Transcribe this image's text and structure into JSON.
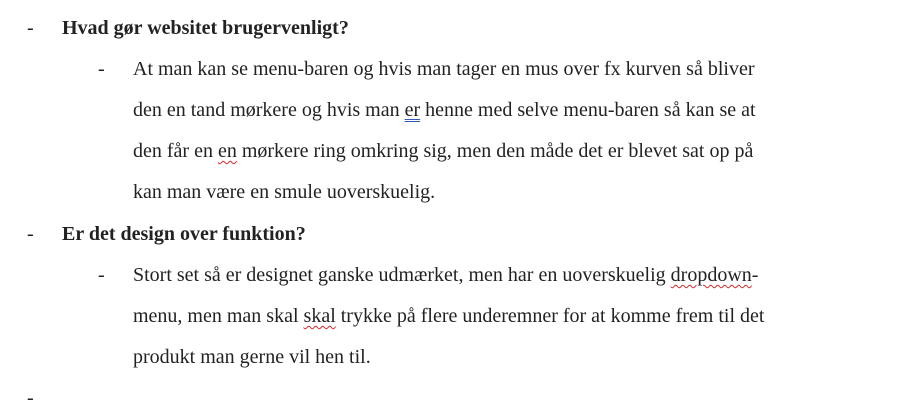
{
  "bullets": {
    "dash": "-"
  },
  "q1": {
    "title": "Hvad gør websitet brugervenligt?",
    "answer": {
      "l1": "At man kan se menu-baren og hvis man tager en mus over fx kurven så bliver",
      "l2_a": "den en tand mørkere og hvis man ",
      "l2_flag": "er",
      "l2_b": " henne med selve menu-baren så kan se at",
      "l3_a": "den får en ",
      "l3_flag": "en",
      "l3_b": " mørkere ring omkring sig, men den måde det er blevet sat op på",
      "l4": "kan man være en smule uoverskuelig."
    }
  },
  "q2": {
    "title": "Er det design over funktion?",
    "answer": {
      "l1_a": "Stort set så er designet ganske udmærket, men har en uoverskuelig ",
      "l1_flag": "dropdown",
      "l1_b": "-",
      "l2_a": "menu, men man skal ",
      "l2_flag": "skal",
      "l2_b": " trykke på flere underemner for at komme frem til det",
      "l3": "produkt man gerne vil hen til."
    }
  },
  "spellcheck_colors": {
    "red": "#d22b2b",
    "blue": "#2e5cb8"
  }
}
